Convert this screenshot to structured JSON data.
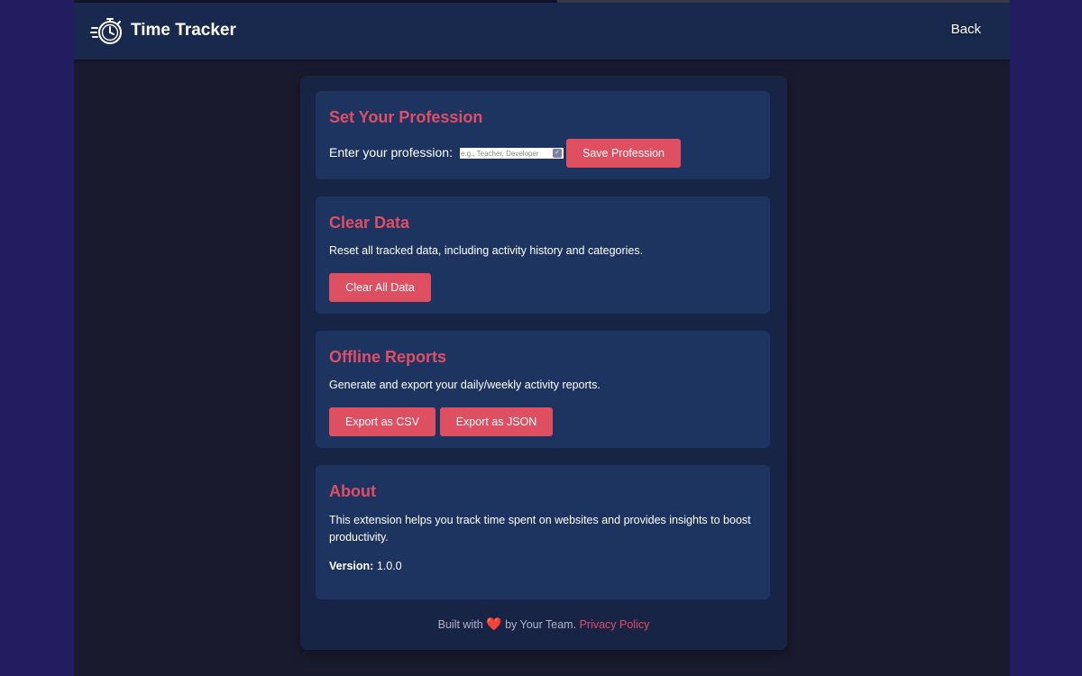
{
  "header": {
    "title": "Time Tracker",
    "back_label": "Back",
    "logo_icon": "stopwatch-icon"
  },
  "profession": {
    "heading": "Set Your Profession",
    "label": "Enter your profession:",
    "placeholder": "e.g., Teacher, Developer",
    "value": "",
    "save_label": "Save Profession"
  },
  "clear_data": {
    "heading": "Clear Data",
    "description": "Reset all tracked data, including activity history and categories.",
    "button_label": "Clear All Data"
  },
  "reports": {
    "heading": "Offline Reports",
    "description": "Generate and export your daily/weekly activity reports.",
    "csv_label": "Export as CSV",
    "json_label": "Export as JSON"
  },
  "about": {
    "heading": "About",
    "description": "This extension helps you track time spent on websites and provides insights to boost productivity.",
    "version_label": "Version:",
    "version_value": "1.0.0"
  },
  "footer": {
    "prefix": "Built with",
    "heart": "❤️",
    "suffix": "by Your Team.",
    "privacy_label": "Privacy Policy"
  },
  "colors": {
    "accent": "#de4f62",
    "card_bg": "#1d3461",
    "header_bg": "#19294d",
    "page_bg": "#1a1a2e"
  }
}
